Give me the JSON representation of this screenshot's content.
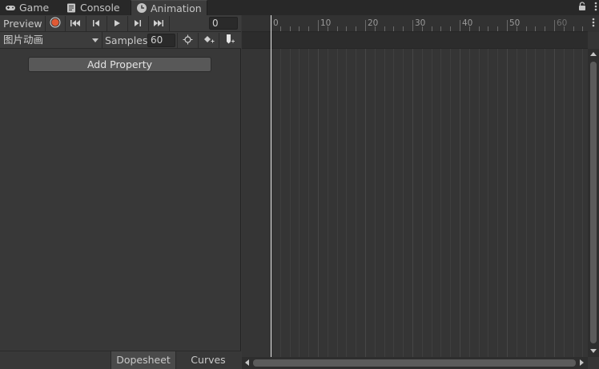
{
  "tabs": [
    {
      "label": "Game",
      "icon": "gamepad-icon",
      "active": false
    },
    {
      "label": "Console",
      "icon": "console-icon",
      "active": false
    },
    {
      "label": "Animation",
      "icon": "clock-icon",
      "active": true
    }
  ],
  "toolbar": {
    "preview_label": "Preview",
    "frame_value": "0",
    "buttons": [
      "record-button",
      "first-key-button",
      "prev-key-button",
      "play-button",
      "next-key-button",
      "last-key-button"
    ]
  },
  "clip": {
    "selected": "图片动画",
    "samples_label": "Samples",
    "samples_value": "60"
  },
  "add_property_label": "Add Property",
  "bottom_tabs": {
    "dopesheet": "Dopesheet",
    "curves": "Curves"
  },
  "timeline": {
    "tick_labels": [
      "0",
      "10",
      "20",
      "30",
      "40",
      "50",
      "60"
    ]
  },
  "colors": {
    "record": "#e05a35",
    "accent_playhead": "#e8e8e8"
  }
}
